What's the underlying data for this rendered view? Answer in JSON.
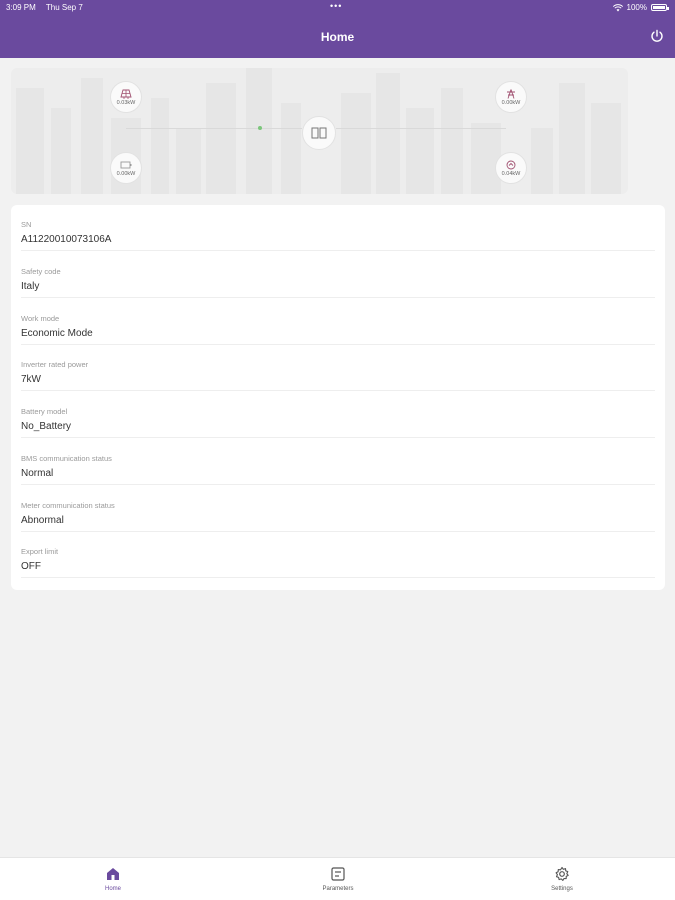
{
  "status_bar": {
    "time": "3:09 PM",
    "date": "Thu Sep 7",
    "battery": "100%"
  },
  "header": {
    "title": "Home",
    "color": "#6a4a9e"
  },
  "energy_flow": {
    "pv_power": "0.03kW",
    "grid_power": "0.00kW",
    "battery_power": "0.00kW",
    "load_power": "0.04kW"
  },
  "info": {
    "rows": [
      {
        "label": "SN",
        "value": "A11220010073106A"
      },
      {
        "label": "Safety code",
        "value": "Italy"
      },
      {
        "label": "Work mode",
        "value": "Economic Mode"
      },
      {
        "label": "Inverter rated power",
        "value": "7kW"
      },
      {
        "label": "Battery model",
        "value": "No_Battery"
      },
      {
        "label": "BMS communication status",
        "value": "Normal"
      },
      {
        "label": "Meter communication status",
        "value": "Abnormal"
      },
      {
        "label": "Export limit",
        "value": "OFF"
      }
    ]
  },
  "tabs": [
    {
      "label": "Home",
      "icon": "home-icon",
      "active": true
    },
    {
      "label": "Parameters",
      "icon": "parameters-icon",
      "active": false
    },
    {
      "label": "Settings",
      "icon": "gear-icon",
      "active": false
    }
  ]
}
